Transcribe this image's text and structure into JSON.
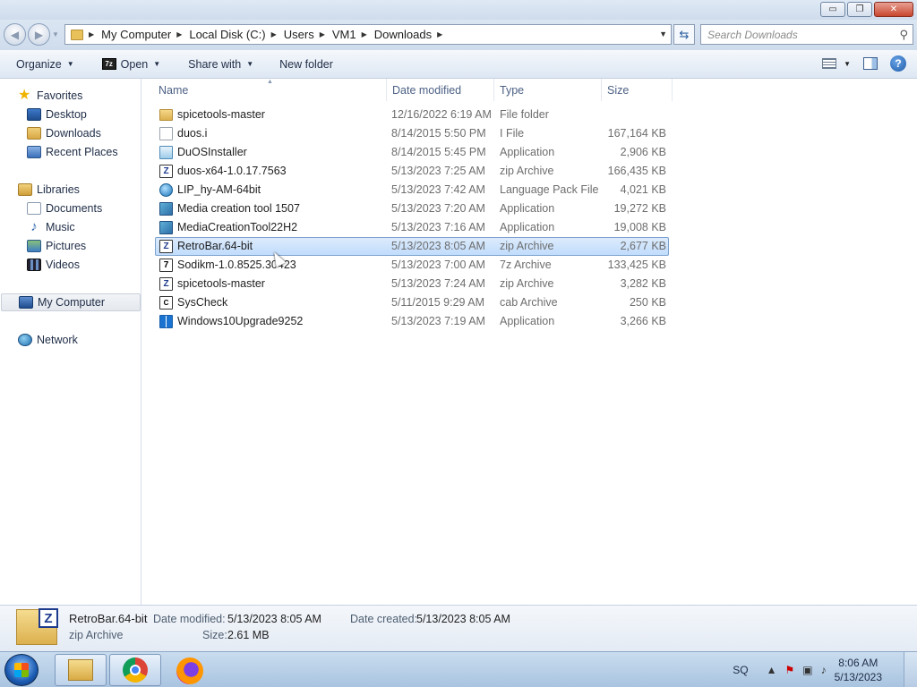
{
  "window": {
    "minimize": "▭",
    "maximize": "❐",
    "close": "✕"
  },
  "address": {
    "crumbs": [
      "My Computer",
      "Local Disk (C:)",
      "Users",
      "VM1",
      "Downloads"
    ],
    "search_placeholder": "Search Downloads"
  },
  "toolbar": {
    "organize": "Organize",
    "open": "Open",
    "share_with": "Share with",
    "new_folder": "New folder"
  },
  "navpane": {
    "favorites": "Favorites",
    "desktop": "Desktop",
    "downloads": "Downloads",
    "recent_places": "Recent Places",
    "libraries": "Libraries",
    "documents": "Documents",
    "music": "Music",
    "pictures": "Pictures",
    "videos": "Videos",
    "my_computer": "My Computer",
    "network": "Network"
  },
  "columns": {
    "name": "Name",
    "date_modified": "Date modified",
    "type": "Type",
    "size": "Size"
  },
  "files": [
    {
      "name": "spicetools-master",
      "date": "12/16/2022 6:19 AM",
      "type": "File folder",
      "size": "",
      "icon": "folder-icon"
    },
    {
      "name": "duos.i",
      "date": "8/14/2015 5:50 PM",
      "type": "I File",
      "size": "167,164 KB",
      "icon": "file-icon"
    },
    {
      "name": "DuOSInstaller",
      "date": "8/14/2015 5:45 PM",
      "type": "Application",
      "size": "2,906 KB",
      "icon": "application-icon"
    },
    {
      "name": "duos-x64-1.0.17.7563",
      "date": "5/13/2023 7:25 AM",
      "type": "zip Archive",
      "size": "166,435 KB",
      "icon": "zip-archive-icon"
    },
    {
      "name": "LIP_hy-AM-64bit",
      "date": "5/13/2023 7:42 AM",
      "type": "Language Pack File",
      "size": "4,021 KB",
      "icon": "language-pack-icon"
    },
    {
      "name": "Media creation tool 1507",
      "date": "5/13/2023 7:20 AM",
      "type": "Application",
      "size": "19,272 KB",
      "icon": "media-tool-icon"
    },
    {
      "name": "MediaCreationTool22H2",
      "date": "5/13/2023 7:16 AM",
      "type": "Application",
      "size": "19,008 KB",
      "icon": "media-tool-icon"
    },
    {
      "name": "RetroBar.64-bit",
      "date": "5/13/2023 8:05 AM",
      "type": "zip Archive",
      "size": "2,677 KB",
      "icon": "zip-archive-icon"
    },
    {
      "name": "Sodikm-1.0.8525.30423",
      "date": "5/13/2023 7:00 AM",
      "type": "7z Archive",
      "size": "133,425 KB",
      "icon": "7z-archive-icon"
    },
    {
      "name": "spicetools-master",
      "date": "5/13/2023 7:24 AM",
      "type": "zip Archive",
      "size": "3,282 KB",
      "icon": "zip-archive-icon"
    },
    {
      "name": "SysCheck",
      "date": "5/11/2015 9:29 AM",
      "type": "cab Archive",
      "size": "250 KB",
      "icon": "cab-archive-icon"
    },
    {
      "name": "Windows10Upgrade9252",
      "date": "5/13/2023 7:19 AM",
      "type": "Application",
      "size": "3,266 KB",
      "icon": "windows-logo-icon"
    }
  ],
  "selected_index": 7,
  "details": {
    "name": "RetroBar.64-bit",
    "type": "zip Archive",
    "date_modified_label": "Date modified:",
    "date_modified": "5/13/2023 8:05 AM",
    "date_created_label": "Date created:",
    "date_created": "5/13/2023 8:05 AM",
    "size_label": "Size:",
    "size": "2.61 MB"
  },
  "taskbar": {
    "language": "SQ",
    "time": "8:06 AM",
    "date": "5/13/2023"
  },
  "colors": {
    "selection": "#cde3fb",
    "selection_border": "#7da2ce",
    "header_text": "#4d6185"
  }
}
